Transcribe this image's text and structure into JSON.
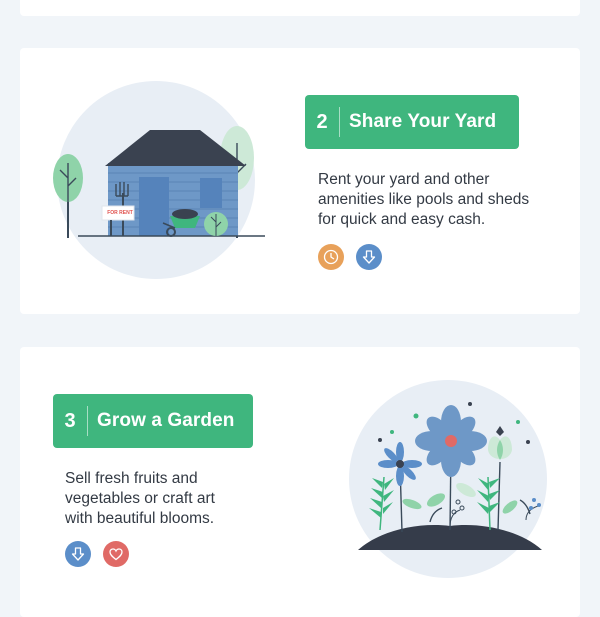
{
  "colors": {
    "background": "#f1f5f9",
    "card": "#ffffff",
    "accent_green": "#3fb67e",
    "text": "#333a44",
    "circle_bg": "#e8eef5",
    "icon_orange": "#e8a15a",
    "icon_blue": "#5b8ec9",
    "icon_red": "#e06a66"
  },
  "steps": [
    {
      "number": "2",
      "title": "Share Your Yard",
      "description": "Rent your yard and other\namenities like pools and sheds\nfor quick and easy cash.",
      "sign_text": "FOR RENT",
      "icons": [
        "clock-icon",
        "arrow-down-icon"
      ]
    },
    {
      "number": "3",
      "title": "Grow a Garden",
      "description": "Sell fresh fruits and\nvegetables or craft art\nwith beautiful blooms.",
      "icons": [
        "arrow-down-icon",
        "heart-icon"
      ]
    }
  ]
}
